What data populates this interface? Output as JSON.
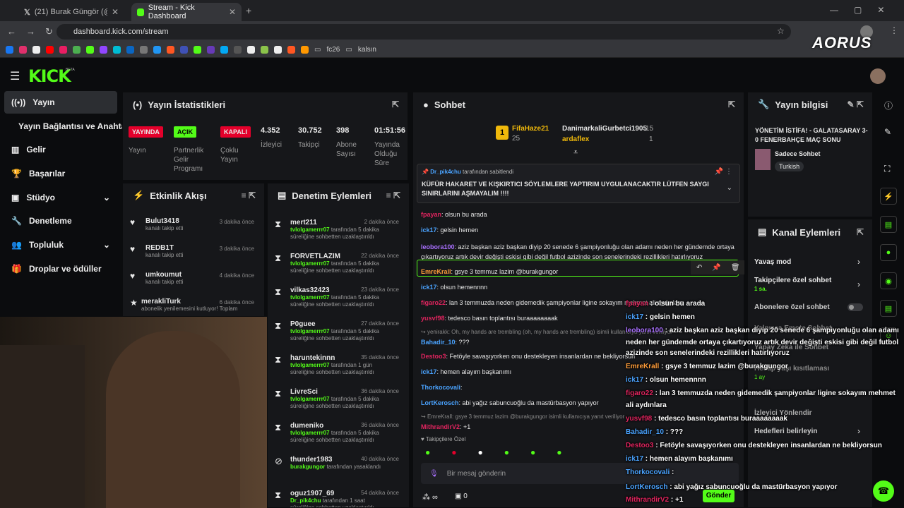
{
  "browser": {
    "tabs": [
      {
        "label": "(21) Burak Güngör (@gungorb..."
      },
      {
        "label": "Stream - Kick Dashboard"
      }
    ],
    "url": "dashboard.kick.com/stream",
    "bookmarks": [
      "fc26",
      "kalsın"
    ]
  },
  "brand": {
    "logo": "KICK",
    "beta": "BETA",
    "aorus": "AORUS"
  },
  "nav": [
    {
      "label": "Yayın"
    },
    {
      "label": "Yayın Bağlantısı ve Anahtarı"
    },
    {
      "label": "Gelir"
    },
    {
      "label": "Başarılar"
    },
    {
      "label": "Stüdyo"
    },
    {
      "label": "Denetleme"
    },
    {
      "label": "Topluluk"
    },
    {
      "label": "Droplar ve ödüller"
    }
  ],
  "stats": {
    "title": "Yayın İstatistikleri",
    "items": [
      {
        "badge": "YAYINDA",
        "label": "Yayın"
      },
      {
        "badge": "AÇIK",
        "label": "Partnerlik Gelir Programı"
      },
      {
        "badge": "KAPALI",
        "label": "Çoklu Yayın"
      },
      {
        "value": "4.352",
        "label": "İzleyici"
      },
      {
        "value": "30.752",
        "label": "Takipçi"
      },
      {
        "value": "398",
        "label": "Abone Sayısı"
      },
      {
        "value": "01:51:56",
        "label": "Yayında Olduğu Süre"
      }
    ]
  },
  "activity": {
    "title": "Etkinlik Akışı",
    "items": [
      {
        "name": "Bulut3418",
        "sub": "kanalı takip etti",
        "time": "3 dakika önce"
      },
      {
        "name": "REDB1T",
        "sub": "kanalı takip etti",
        "time": "3 dakika önce"
      },
      {
        "name": "umkoumut",
        "sub": "kanalı takip etti",
        "time": "4 dakika önce"
      },
      {
        "name": "merakliTurk",
        "sub": "abonelik yenilemesini kutluyor! Toplam",
        "time": "6 dakika önce"
      }
    ]
  },
  "moderation": {
    "title": "Denetim Eylemleri",
    "items": [
      {
        "name": "mert211",
        "mod": "tvlolgamerrr07",
        "rest": "tarafından 5 dakika süreliğine sohbetten uzaklaştırıldı",
        "time": "2 dakika önce"
      },
      {
        "name": "FORVETLAZIM",
        "mod": "tvlolgamerrr07",
        "rest": "tarafından 5 dakika süreliğine sohbetten uzaklaştırıldı",
        "time": "22 dakika önce"
      },
      {
        "name": "vilkas32423",
        "mod": "tvlolgamerrr07",
        "rest": "tarafından 5 dakika süreliğine sohbetten uzaklaştırıldı",
        "time": "23 dakika önce"
      },
      {
        "name": "P0guee",
        "mod": "tvlolgamerrr07",
        "rest": "tarafından 5 dakika süreliğine sohbetten uzaklaştırıldı",
        "time": "27 dakika önce"
      },
      {
        "name": "haruntekinnn",
        "mod": "tvlolgamerrr07",
        "rest": "tarafından 1 gün süreliğine sohbetten uzaklaştırıldı",
        "time": "35 dakika önce"
      },
      {
        "name": "LivreSci",
        "mod": "tvlolgamerrr07",
        "rest": "tarafından 5 dakika süreliğine sohbetten uzaklaştırıldı",
        "time": "36 dakika önce"
      },
      {
        "name": "dumeniko",
        "mod": "tvlolgamerrr07",
        "rest": "tarafından 5 dakika süreliğine sohbetten uzaklaştırıldı",
        "time": "36 dakika önce"
      },
      {
        "name": "thunder1983",
        "mod": "burakgungor",
        "rest": "tarafından yasaklandı",
        "time": "40 dakika önce"
      },
      {
        "name": "oguz1907_69",
        "mod": "Dr_pik4chu",
        "rest": "tarafından 1 saat süreliğine sohbetten uzaklaştırıldı",
        "time": "54 dakika önce"
      }
    ]
  },
  "chat": {
    "title": "Sohbet",
    "top": [
      {
        "name": "FifaHaze21",
        "count": "25"
      },
      {
        "name": "DanimarkaliGurbetci1905",
        "count": "15"
      },
      {
        "name": "ardaflex",
        "count": "1"
      }
    ],
    "pinned_by": "Dr_pik4chu",
    "pinned_by_suffix": "tarafından sabitlendi",
    "pinned_text": "KÜFÜR HAKARET VE KIŞKIRTICI SÖYLEMLERE YAPTIRIM UYGULANACAKTIR LÜTFEN SAYGI SINIRLARINI AŞMAYALIM !!!!",
    "messages": [
      {
        "user": "fpayan",
        "text": "olsun bu arada",
        "color": "#e0245e"
      },
      {
        "user": "ick17",
        "text": "gelsin hemen",
        "color": "#4aa3ff"
      },
      {
        "user": "leobora100",
        "text": "aziz başkan aziz başkan diyip 20 senede 6 şampiyonluğu olan adamı neden her gündemde ortaya çıkartıyoruz artık devir değişti eskisi gibi değil futbol azizinde son senelerindeki rezillikleri hatırlıyoruz",
        "color": "#a970ff"
      },
      {
        "user": "EmreKrall",
        "text": "gsye 3 temmuz lazim @burakgungor",
        "color": "#ff9d3a"
      },
      {
        "user": "ick17",
        "text": "olsun hemennnn",
        "color": "#4aa3ff"
      },
      {
        "user": "figaro22",
        "text": "lan 3 temmuzda neden gidemedik şampiyonlar ligine sokayım mehmet ali aydınlara",
        "color": "#e0245e"
      },
      {
        "user": "yusvf98",
        "text": "tedesco basın toplantısı buraaaaaaaak",
        "color": "#e0245e"
      },
      {
        "user": "",
        "text": "yenirakk: Oh, my hands are trembling (oh, my hands are trembling) isimli kullanıcıya yanıt veriliyor",
        "color": "#888"
      },
      {
        "user": "Bahadir_10",
        "text": "???",
        "color": "#4aa3ff"
      },
      {
        "user": "Destoo3",
        "text": "Fetöyle savaşıyorken onu destekleyen insanlardan ne bekliyorsun",
        "color": "#e0245e"
      },
      {
        "user": "ick17",
        "text": "hemen alayım başkanımı",
        "color": "#4aa3ff"
      },
      {
        "user": "Thorkocovali",
        "text": "",
        "color": "#4aa3ff"
      },
      {
        "user": "LortKerosch",
        "text": "abi yağız sabuncuoğlu da mastürbasyon yapıyor",
        "color": "#4aa3ff"
      },
      {
        "user": "",
        "text": "EmreKrall: gsye 3 temmuz lazim @burakgungor isimli kullanıcıya yanıt veriliyor",
        "color": "#888"
      },
      {
        "user": "MithrandirV2",
        "text": "+1",
        "color": "#e0245e"
      }
    ],
    "followers_only": "Takipçilere Özel",
    "placeholder": "Bir mesaj gönderin",
    "send": "Gönder",
    "viewers": "0"
  },
  "overlay": [
    {
      "user": "fpayan",
      "text": " : olsun bu arada"
    },
    {
      "user": "ick17",
      "text": " : gelsin hemen"
    },
    {
      "user": "leobora100",
      "text": " : aziz başkan aziz başkan diyip 20 senede 6 şampiyonluğu olan adamı"
    },
    {
      "user": "",
      "text": "neden her gündemde ortaya çıkartıyoruz artık devir değişti eskisi gibi değil futbol"
    },
    {
      "user": "",
      "text": "azizinde son senelerindeki rezillikleri hatırlıyoruz"
    },
    {
      "user": "EmreKrall",
      "text": " : gsye 3 temmuz lazim @burakgungor"
    },
    {
      "user": "ick17",
      "text": " : olsun hemennnn"
    },
    {
      "user": "figaro22",
      "text": " : lan 3 temmuzda neden gidemedik şampiyonlar ligine sokayım mehmet"
    },
    {
      "user": "",
      "text": "ali aydınlara"
    },
    {
      "user": "yusvf98",
      "text": " : tedesco basın toplantısı buraaaaaaaak"
    },
    {
      "user": "Bahadir_10",
      "text": " : ???"
    },
    {
      "user": "Destoo3",
      "text": " : Fetöyle savaşıyorken onu destekleyen insanlardan ne bekliyorsun"
    },
    {
      "user": "ick17",
      "text": " : hemen alayım başkanımı"
    },
    {
      "user": "Thorkocovali",
      "text": " :"
    },
    {
      "user": "LortKerosch",
      "text": " : abi yağız sabuncuoğlu da mastürbasyon yapıyor"
    },
    {
      "user": "MithrandirV2",
      "text": " : +1"
    }
  ],
  "info": {
    "title": "Yayın bilgisi",
    "stream_title": "YÖNETİM İSTİFA! - GALATASARAY 3-0 FENERBAHÇE MAÇ SONU",
    "category": "Sadece Sohbet",
    "tag": "Turkish"
  },
  "actions": {
    "title": "Kanal Eylemleri",
    "items": [
      {
        "label": "Yavaş mod"
      },
      {
        "label": "Takipçilere özel sohbet",
        "sub": "1 sa."
      },
      {
        "label": "Abonelere özel sohbet"
      },
      {
        "label": "Yalnızca Emote Sohbet"
      },
      {
        "label": "Yapay Zeka ile Sohbet"
      },
      {
        "label": "Hesap yaşı kısıtlaması",
        "sub": "1 ay"
      },
      {
        "label": "İzleyici Yönlendir"
      },
      {
        "label": "Hedefleri belirleyin"
      }
    ]
  },
  "colors": {
    "accent": "#53fc18",
    "live": "#e4002b",
    "panel": "#16171a"
  }
}
